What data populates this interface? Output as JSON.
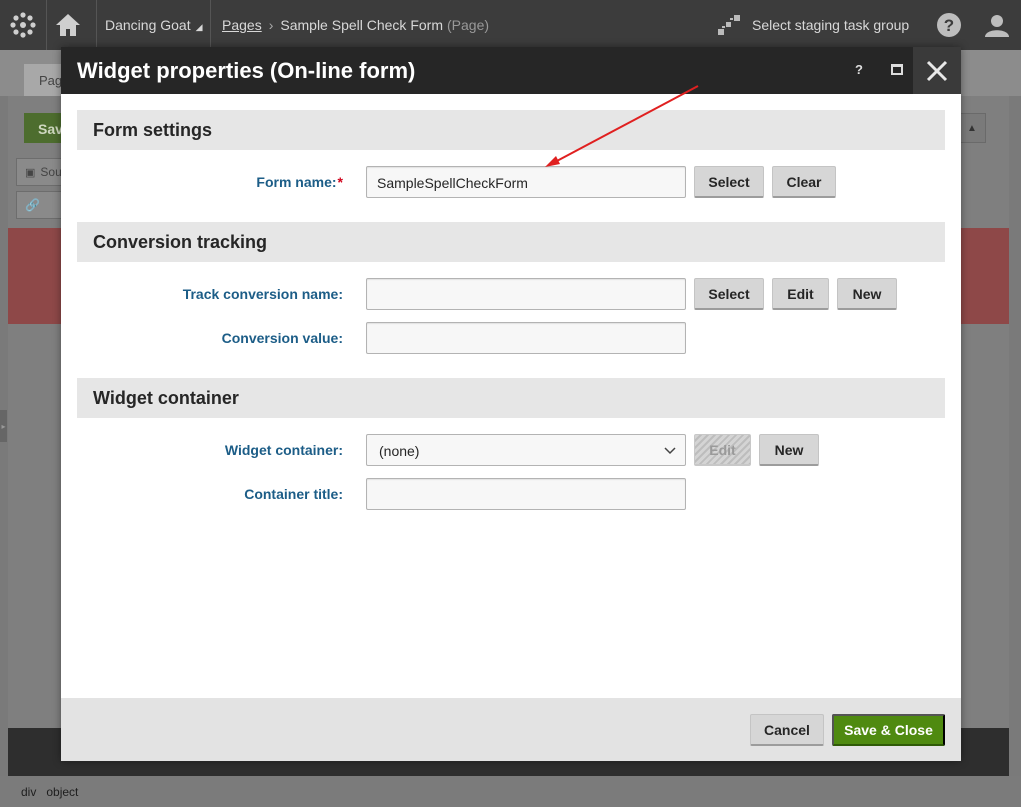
{
  "topbar": {
    "site_name": "Dancing Goat",
    "breadcrumb_root": "Pages",
    "breadcrumb_page": "Sample Spell Check Form",
    "breadcrumb_type": "(Page)",
    "staging_label": "Select staging task group"
  },
  "background": {
    "tab_label": "Pag",
    "save_label": "Sav",
    "source_label": "Sou"
  },
  "dialog": {
    "title": "Widget properties (On-line form)",
    "help_label": "?",
    "sections": {
      "form_settings": "Form settings",
      "conversion_tracking": "Conversion tracking",
      "widget_container": "Widget container"
    },
    "fields": {
      "form_name": {
        "label": "Form name:",
        "required_mark": "*",
        "value": "SampleSpellCheckForm"
      },
      "track_conversion_name": {
        "label": "Track conversion name:",
        "value": ""
      },
      "conversion_value": {
        "label": "Conversion value:",
        "value": ""
      },
      "widget_container": {
        "label": "Widget container:",
        "selected": "(none)"
      },
      "container_title": {
        "label": "Container title:",
        "value": ""
      }
    },
    "buttons": {
      "select": "Select",
      "clear": "Clear",
      "edit": "Edit",
      "new": "New",
      "cancel": "Cancel",
      "save_close": "Save & Close"
    }
  },
  "statusbar": {
    "items": [
      "div",
      "object"
    ]
  },
  "colors": {
    "topbar_bg": "#3c3c3c",
    "dialog_header_bg": "#262626",
    "label_blue": "#1c5d87",
    "required_red": "#d0021b",
    "primary_green": "#4f8a10",
    "annotation_arrow": "#e02020"
  }
}
